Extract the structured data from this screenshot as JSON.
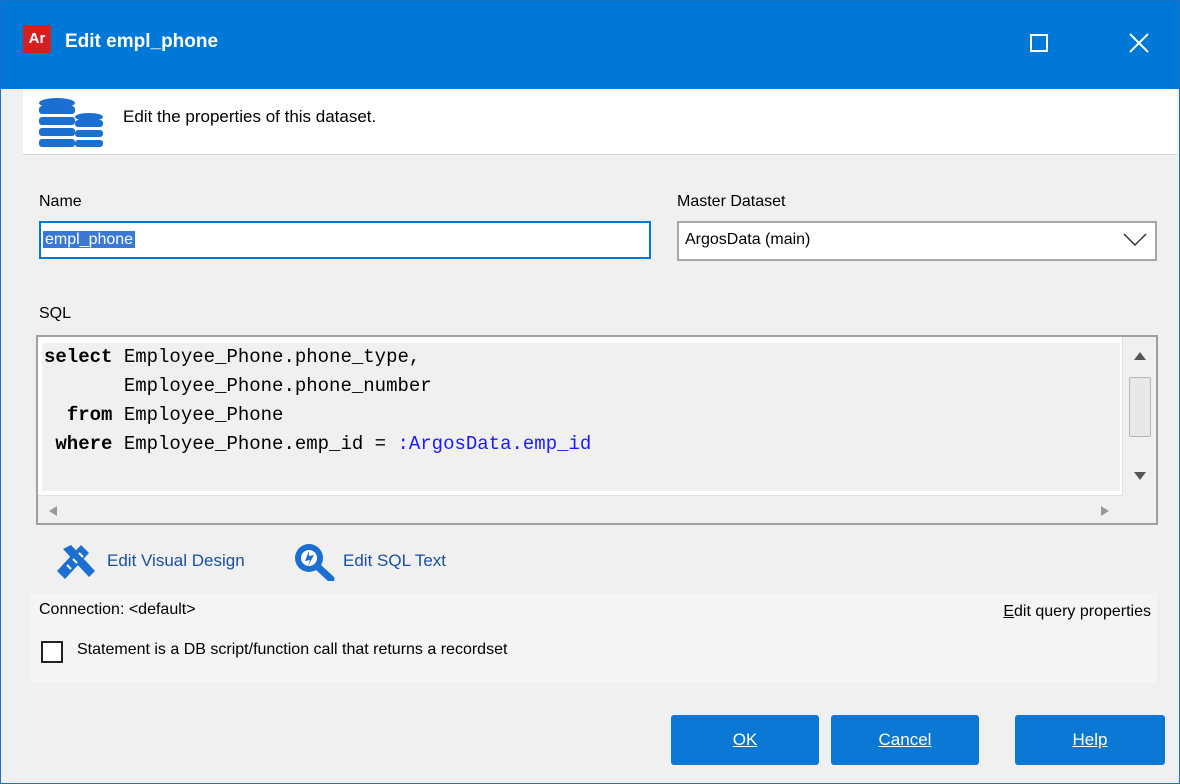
{
  "window": {
    "app_icon": "Ar",
    "title": "Edit empl_phone",
    "maximize_icon": "maximize-icon",
    "close_icon": "close-icon"
  },
  "header": {
    "icon": "database-icon",
    "text": "Edit the properties of this dataset."
  },
  "form": {
    "name_label": "Name",
    "name_value": "empl_phone",
    "master_label": "Master Dataset",
    "master_value": "ArgosData (main)",
    "sql_label": "SQL",
    "sql_lines": [
      {
        "kw": "select",
        "indent": "",
        "rest": " Employee_Phone.phone_type,",
        "param": ""
      },
      {
        "kw": "",
        "indent": "       ",
        "rest": "Employee_Phone.phone_number",
        "param": ""
      },
      {
        "kw": "from",
        "indent": "  ",
        "rest": " Employee_Phone",
        "param": ""
      },
      {
        "kw": "where",
        "indent": " ",
        "rest": " Employee_Phone.emp_id = ",
        "param": ":ArgosData.emp_id"
      }
    ]
  },
  "actions": {
    "visual_design_label": "Edit Visual Design",
    "sql_text_label": "Edit SQL Text"
  },
  "connection": {
    "text": "Connection: <default>",
    "query_props_first": "E",
    "query_props_rest": "dit query properties",
    "checkbox_label": "Statement is a DB script/function call that returns a recordset",
    "checked": false
  },
  "buttons": {
    "ok": "OK",
    "cancel": "Cancel",
    "help": "Help"
  },
  "colors": {
    "titlebar": "#0078d7",
    "button": "#0a78d4",
    "param": "#1a1aff",
    "link": "#1a4fa0"
  }
}
